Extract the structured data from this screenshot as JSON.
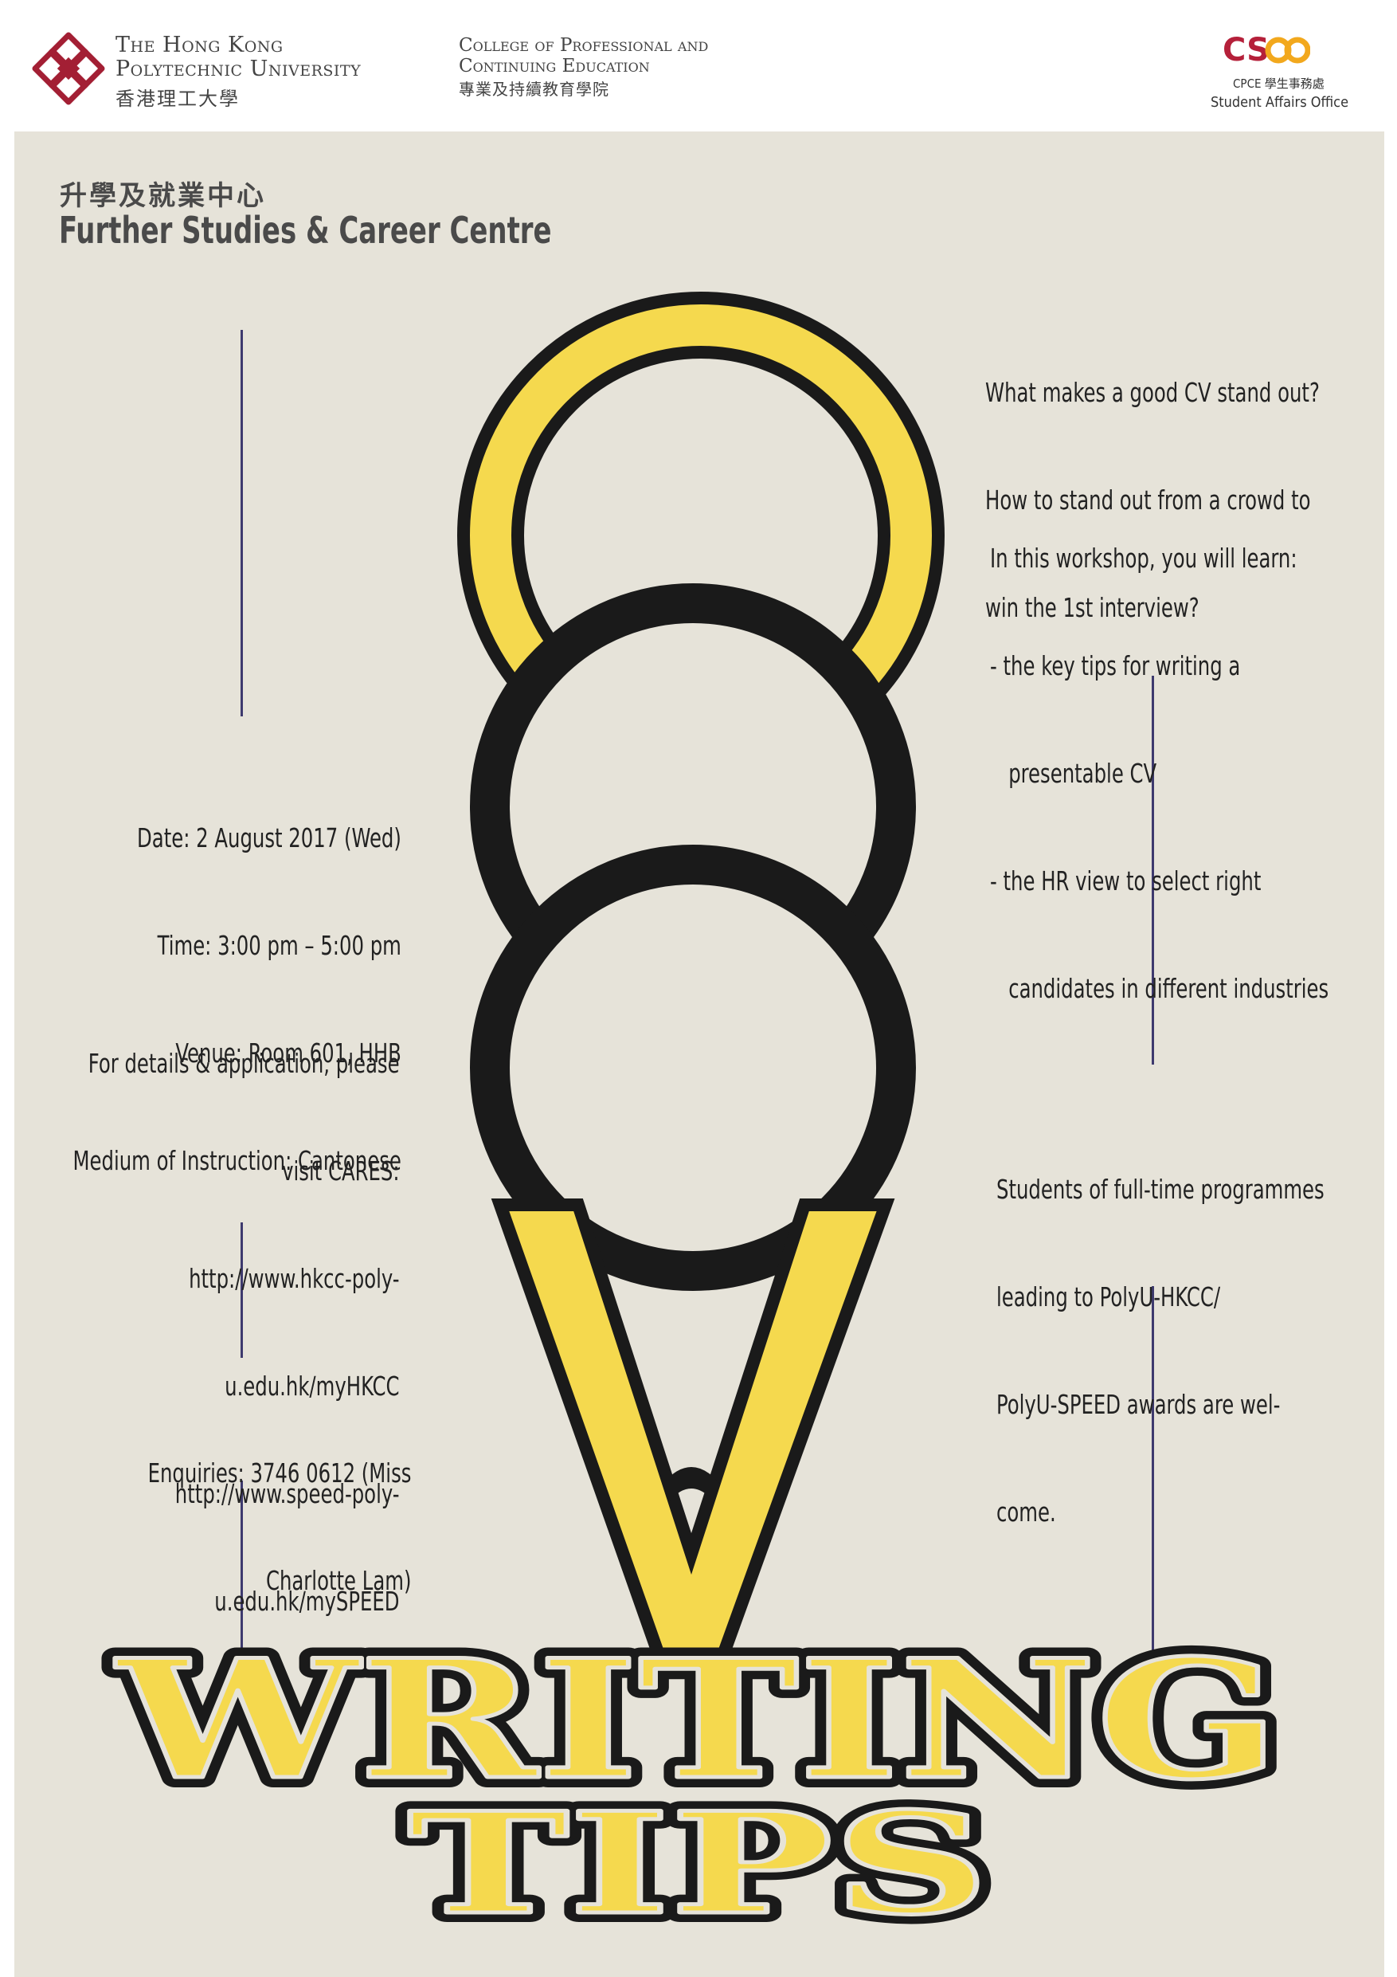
{
  "header": {
    "university_en_line1": "The Hong Kong",
    "university_en_line2": "Polytechnic University",
    "university_zh": "香港理工大學",
    "college_en_line1": "College of Professional and",
    "college_en_line2": "Continuing Education",
    "college_zh": "專業及持續教育學院",
    "csao_logo_text": "CSAO",
    "csao_zh": "CPCE 學生事務處",
    "csao_en": "Student Affairs Office"
  },
  "centre": {
    "name_zh": "升學及就業中心",
    "name_en": "Further Studies & Career Centre"
  },
  "intro": {
    "lines": [
      "What makes a good CV stand out?",
      "How to stand out from a crowd to",
      "win the 1st interview?"
    ]
  },
  "workshop": {
    "lines": [
      "In this workshop, you will learn:",
      "- the key tips for writing a",
      "   presentable CV",
      "- the HR view to select right",
      "   candidates in different industries"
    ]
  },
  "event": {
    "date": "Date: 2 August 2017 (Wed)",
    "time": "Time: 3:00 pm – 5:00 pm",
    "venue": "Venue: Room 601, HHB",
    "medium": "Medium of Instruction: Cantonese"
  },
  "details": {
    "lines": [
      "For details & application, please",
      "visit CARES:",
      "http://www.hkcc-poly-",
      "u.edu.hk/myHKCC",
      "http://www.speed-poly-",
      "u.edu.hk/mySPEED"
    ]
  },
  "eligibility": {
    "lines": [
      "Students of full-time programmes",
      "leading to PolyU-HKCC/",
      "PolyU-SPEED awards are wel-",
      "come."
    ]
  },
  "enquiries": {
    "lines": [
      "Enquiries: 3746 0612 (Miss",
      "Charlotte Lam)"
    ]
  },
  "title": {
    "line1": "WRITING",
    "line2": "TIPS"
  },
  "colors": {
    "background": "#e6e3d9",
    "accent_yellow": "#f5d94e",
    "outline": "#1a1a1a",
    "logo_red": "#a31f34",
    "rule": "#3e3a6e"
  }
}
